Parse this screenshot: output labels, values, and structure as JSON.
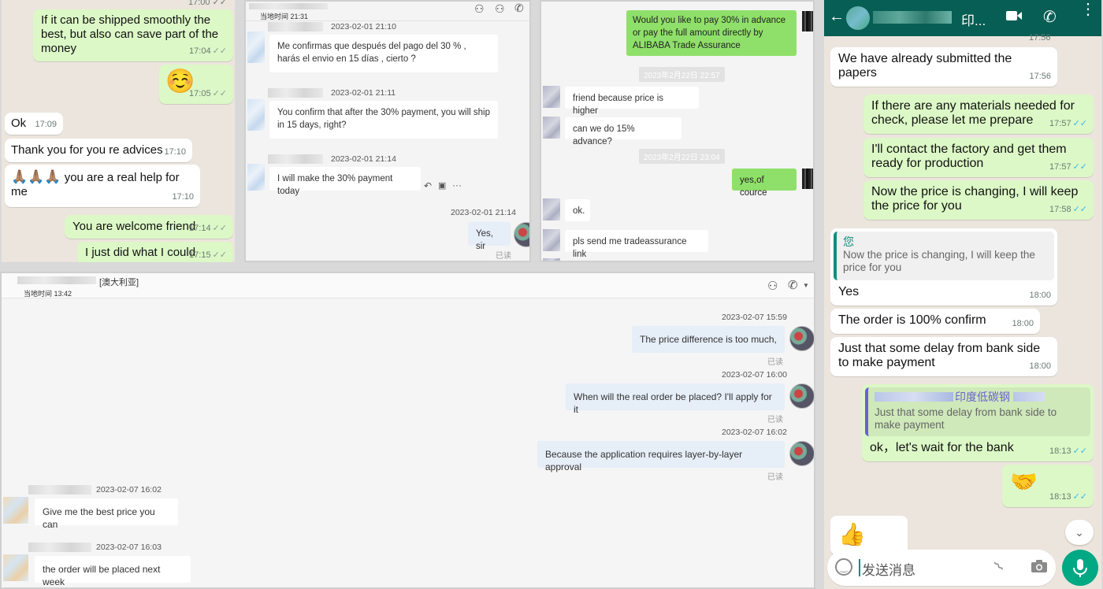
{
  "p1": {
    "msgs": [
      {
        "text": "If it can be shipped smoothly the best, but also can save part of the money",
        "time": "17:04"
      },
      {
        "text": "☺️",
        "time": "17:05"
      },
      {
        "text": "Ok",
        "time": "17:09"
      },
      {
        "text": "Thank you for you re advices",
        "time": "17:10"
      },
      {
        "emoji": "🙏🏽🙏🏽🙏🏽",
        "text": "you are a real help for me",
        "time": "17:10"
      },
      {
        "text": "You are welcome friend",
        "time": "17:14"
      },
      {
        "text": "I just did what I could",
        "time": "17:15"
      }
    ],
    "ticks": "✓✓"
  },
  "p2": {
    "local_time": "当地时间 21:31",
    "msgs": [
      {
        "time": "2023-02-01 21:10",
        "text": "Me confirmas que después del pago del 30 % , harás el envio en 15 días , cierto ?"
      },
      {
        "time": "2023-02-01 21:11",
        "text": "You confirm that after the 30% payment, you will ship in 15 days, right?"
      },
      {
        "time": "2023-02-01 21:14",
        "text": "I will make the 30% payment today"
      },
      {
        "time": "2023-02-01 21:14",
        "text": "Yes, sir"
      }
    ],
    "read": "已读"
  },
  "p3": {
    "msgs": [
      {
        "text": "Would you like to pay 30% in advance or pay the full amount directly by ALIBABA Trade Assurance"
      },
      {
        "date": "2023年2月22日 22:57"
      },
      {
        "text": "friend because price is higher"
      },
      {
        "text": "can we do 15% advance?"
      },
      {
        "date": "2023年2月22日 23:04"
      },
      {
        "text": "yes,of cource"
      },
      {
        "text": "ok."
      },
      {
        "text": "pls send me tradeassurance link"
      }
    ]
  },
  "p4": {
    "country": "[澳大利亚]",
    "local_time": "当地时间 13:42",
    "msgs": [
      {
        "time": "2023-02-07 15:59",
        "text": "The price difference is too much,"
      },
      {
        "time": "2023-02-07 16:00",
        "text": "When will the real order be placed? I'll apply for it"
      },
      {
        "time": "2023-02-07 16:02",
        "text": "Because the application requires layer-by-layer approval"
      },
      {
        "time": "2023-02-07 16:02",
        "text": "Give me the best price you can"
      },
      {
        "time": "2023-02-07 16:03",
        "text": "the order will be placed next week"
      }
    ],
    "read": "已读"
  },
  "p5": {
    "header_name": "印...",
    "top_time": "17:56",
    "msgs": [
      {
        "text": "We have already submitted the papers",
        "time": "17:56"
      },
      {
        "text": "If there are any materials needed for check, please let me prepare",
        "time": "17:57"
      },
      {
        "text": "I'll contact the factory and get them ready for production",
        "time": "17:57"
      },
      {
        "text": "Now the price is changing, I will keep the  price for you",
        "time": "17:58"
      },
      {
        "quote_author": "您",
        "quote_text": "Now the price is changing, I will keep the price for you",
        "text": "Yes",
        "time": "18:00"
      },
      {
        "text": "The order is 100% confirm",
        "time": "18:00"
      },
      {
        "text": "Just that some delay from bank side to make payment",
        "time": "18:00"
      },
      {
        "quote_author": "印度低碳钢",
        "quote_text": "Just that some delay from bank side to make payment",
        "text": "ok，let's wait for the bank",
        "time": "18:13"
      },
      {
        "text": "🤝",
        "time": "18:13"
      },
      {
        "text": "👍"
      }
    ],
    "input_placeholder": "发送消息",
    "ticks": "✓✓",
    "colors": {
      "header": "#075e54",
      "accent": "#128c7e",
      "mic": "#00a884"
    }
  }
}
